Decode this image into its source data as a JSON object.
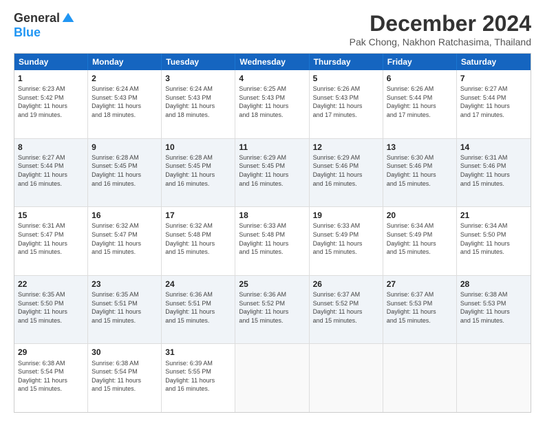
{
  "logo": {
    "general": "General",
    "blue": "Blue"
  },
  "title": "December 2024",
  "location": "Pak Chong, Nakhon Ratchasima, Thailand",
  "headers": [
    "Sunday",
    "Monday",
    "Tuesday",
    "Wednesday",
    "Thursday",
    "Friday",
    "Saturday"
  ],
  "weeks": [
    [
      {
        "day": "1",
        "text": "Sunrise: 6:23 AM\nSunset: 5:42 PM\nDaylight: 11 hours\nand 19 minutes."
      },
      {
        "day": "2",
        "text": "Sunrise: 6:24 AM\nSunset: 5:43 PM\nDaylight: 11 hours\nand 18 minutes."
      },
      {
        "day": "3",
        "text": "Sunrise: 6:24 AM\nSunset: 5:43 PM\nDaylight: 11 hours\nand 18 minutes."
      },
      {
        "day": "4",
        "text": "Sunrise: 6:25 AM\nSunset: 5:43 PM\nDaylight: 11 hours\nand 18 minutes."
      },
      {
        "day": "5",
        "text": "Sunrise: 6:26 AM\nSunset: 5:43 PM\nDaylight: 11 hours\nand 17 minutes."
      },
      {
        "day": "6",
        "text": "Sunrise: 6:26 AM\nSunset: 5:44 PM\nDaylight: 11 hours\nand 17 minutes."
      },
      {
        "day": "7",
        "text": "Sunrise: 6:27 AM\nSunset: 5:44 PM\nDaylight: 11 hours\nand 17 minutes."
      }
    ],
    [
      {
        "day": "8",
        "text": "Sunrise: 6:27 AM\nSunset: 5:44 PM\nDaylight: 11 hours\nand 16 minutes."
      },
      {
        "day": "9",
        "text": "Sunrise: 6:28 AM\nSunset: 5:45 PM\nDaylight: 11 hours\nand 16 minutes."
      },
      {
        "day": "10",
        "text": "Sunrise: 6:28 AM\nSunset: 5:45 PM\nDaylight: 11 hours\nand 16 minutes."
      },
      {
        "day": "11",
        "text": "Sunrise: 6:29 AM\nSunset: 5:45 PM\nDaylight: 11 hours\nand 16 minutes."
      },
      {
        "day": "12",
        "text": "Sunrise: 6:29 AM\nSunset: 5:46 PM\nDaylight: 11 hours\nand 16 minutes."
      },
      {
        "day": "13",
        "text": "Sunrise: 6:30 AM\nSunset: 5:46 PM\nDaylight: 11 hours\nand 15 minutes."
      },
      {
        "day": "14",
        "text": "Sunrise: 6:31 AM\nSunset: 5:46 PM\nDaylight: 11 hours\nand 15 minutes."
      }
    ],
    [
      {
        "day": "15",
        "text": "Sunrise: 6:31 AM\nSunset: 5:47 PM\nDaylight: 11 hours\nand 15 minutes."
      },
      {
        "day": "16",
        "text": "Sunrise: 6:32 AM\nSunset: 5:47 PM\nDaylight: 11 hours\nand 15 minutes."
      },
      {
        "day": "17",
        "text": "Sunrise: 6:32 AM\nSunset: 5:48 PM\nDaylight: 11 hours\nand 15 minutes."
      },
      {
        "day": "18",
        "text": "Sunrise: 6:33 AM\nSunset: 5:48 PM\nDaylight: 11 hours\nand 15 minutes."
      },
      {
        "day": "19",
        "text": "Sunrise: 6:33 AM\nSunset: 5:49 PM\nDaylight: 11 hours\nand 15 minutes."
      },
      {
        "day": "20",
        "text": "Sunrise: 6:34 AM\nSunset: 5:49 PM\nDaylight: 11 hours\nand 15 minutes."
      },
      {
        "day": "21",
        "text": "Sunrise: 6:34 AM\nSunset: 5:50 PM\nDaylight: 11 hours\nand 15 minutes."
      }
    ],
    [
      {
        "day": "22",
        "text": "Sunrise: 6:35 AM\nSunset: 5:50 PM\nDaylight: 11 hours\nand 15 minutes."
      },
      {
        "day": "23",
        "text": "Sunrise: 6:35 AM\nSunset: 5:51 PM\nDaylight: 11 hours\nand 15 minutes."
      },
      {
        "day": "24",
        "text": "Sunrise: 6:36 AM\nSunset: 5:51 PM\nDaylight: 11 hours\nand 15 minutes."
      },
      {
        "day": "25",
        "text": "Sunrise: 6:36 AM\nSunset: 5:52 PM\nDaylight: 11 hours\nand 15 minutes."
      },
      {
        "day": "26",
        "text": "Sunrise: 6:37 AM\nSunset: 5:52 PM\nDaylight: 11 hours\nand 15 minutes."
      },
      {
        "day": "27",
        "text": "Sunrise: 6:37 AM\nSunset: 5:53 PM\nDaylight: 11 hours\nand 15 minutes."
      },
      {
        "day": "28",
        "text": "Sunrise: 6:38 AM\nSunset: 5:53 PM\nDaylight: 11 hours\nand 15 minutes."
      }
    ],
    [
      {
        "day": "29",
        "text": "Sunrise: 6:38 AM\nSunset: 5:54 PM\nDaylight: 11 hours\nand 15 minutes."
      },
      {
        "day": "30",
        "text": "Sunrise: 6:38 AM\nSunset: 5:54 PM\nDaylight: 11 hours\nand 15 minutes."
      },
      {
        "day": "31",
        "text": "Sunrise: 6:39 AM\nSunset: 5:55 PM\nDaylight: 11 hours\nand 16 minutes."
      },
      {
        "day": "",
        "text": ""
      },
      {
        "day": "",
        "text": ""
      },
      {
        "day": "",
        "text": ""
      },
      {
        "day": "",
        "text": ""
      }
    ]
  ]
}
